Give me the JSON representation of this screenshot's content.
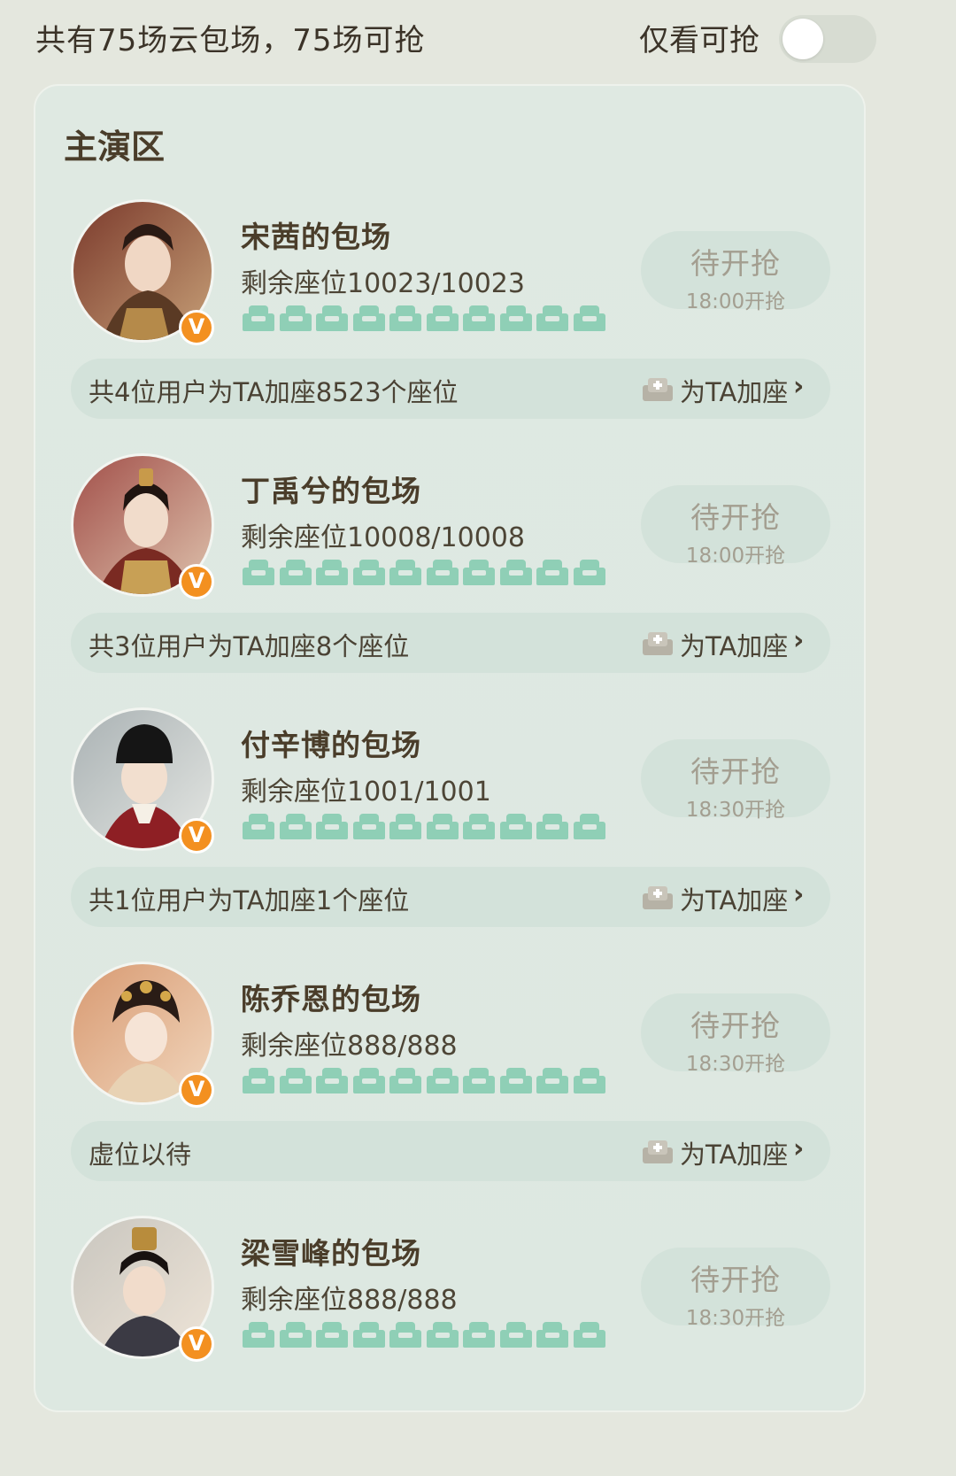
{
  "header": {
    "summary": "共有75场云包场，75场可抢",
    "filter_label": "仅看可抢",
    "filter_on": false
  },
  "section": {
    "title": "主演区"
  },
  "entries": [
    {
      "name": "宋茜的包场",
      "seats": "剩余座位10023/10023",
      "status": "待开抢",
      "time": "18:00开抢",
      "note": "共4位用户为TA加座8523个座位",
      "add_label": "为TA加座"
    },
    {
      "name": "丁禹兮的包场",
      "seats": "剩余座位10008/10008",
      "status": "待开抢",
      "time": "18:00开抢",
      "note": "共3位用户为TA加座8个座位",
      "add_label": "为TA加座"
    },
    {
      "name": "付辛博的包场",
      "seats": "剩余座位1001/1001",
      "status": "待开抢",
      "time": "18:30开抢",
      "note": "共1位用户为TA加座1个座位",
      "add_label": "为TA加座"
    },
    {
      "name": "陈乔恩的包场",
      "seats": "剩余座位888/888",
      "status": "待开抢",
      "time": "18:30开抢",
      "note": "虚位以待",
      "add_label": "为TA加座"
    },
    {
      "name": "梁雪峰的包场",
      "seats": "剩余座位888/888",
      "status": "待开抢",
      "time": "18:30开抢",
      "note": "",
      "add_label": ""
    }
  ],
  "icons": {
    "badge": "verified-v-icon",
    "seat": "seat-icon",
    "add_seat": "add-seat-icon",
    "chevron": "chevron-right-icon"
  },
  "colors": {
    "page_bg": "#e4e7de",
    "panel_bg": "#dfe9e2",
    "pill_bg": "#d3e2da",
    "seat": "#8fcfb6",
    "badge": "#f39020",
    "muted_text": "#a39e90"
  }
}
